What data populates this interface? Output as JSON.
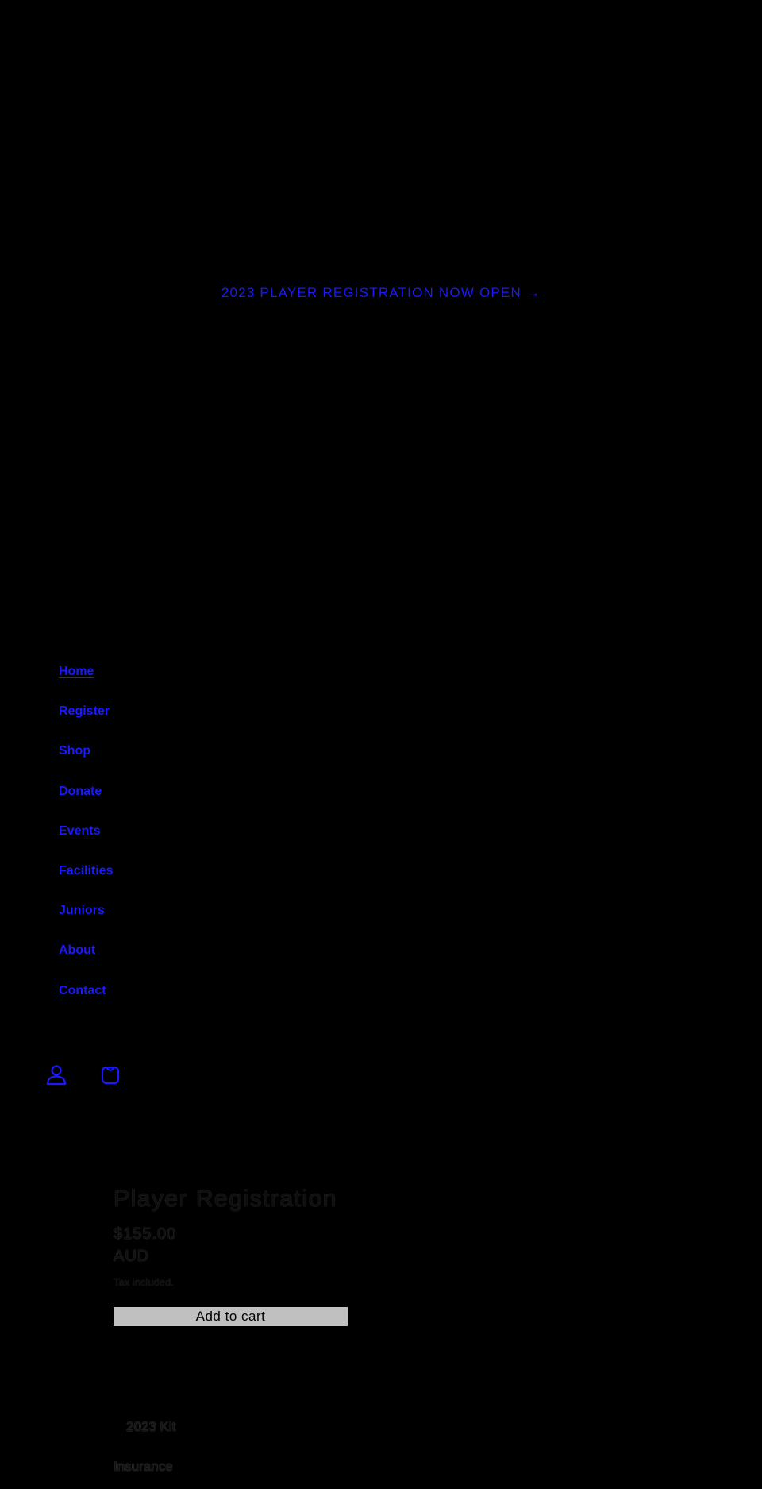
{
  "announcement": {
    "text": "2023 PLAYER REGISTRATION NOW OPEN",
    "arrow": "→"
  },
  "nav": {
    "items": [
      {
        "label": "Home"
      },
      {
        "label": "Register"
      },
      {
        "label": "Shop"
      },
      {
        "label": "Donate"
      },
      {
        "label": "Events"
      },
      {
        "label": "Facilities"
      },
      {
        "label": "Juniors"
      },
      {
        "label": "About"
      },
      {
        "label": "Contact"
      }
    ]
  },
  "header_icons": {
    "account": "account-icon",
    "cart": "cart-icon"
  },
  "product": {
    "title": "Player Registration",
    "price_amount": "$155.00",
    "price_currency": "AUD",
    "tax_note": "Tax included.",
    "add_to_cart_label": "Add to cart",
    "options": {
      "kit_label": "2023 Kit",
      "insurance_label": "Insurance"
    }
  },
  "colors": {
    "background": "#000000",
    "link": "#1a1aff",
    "button": "#c0c0c0"
  }
}
